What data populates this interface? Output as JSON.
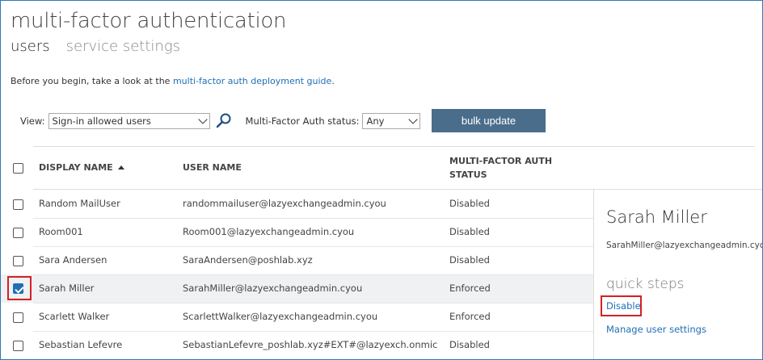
{
  "page": {
    "title": "multi-factor authentication",
    "tabs": [
      {
        "label": "users",
        "active": true
      },
      {
        "label": "service settings",
        "active": false
      }
    ],
    "intro_text": "Before you begin, take a look at the ",
    "intro_link": "multi-factor auth deployment guide",
    "intro_end": "."
  },
  "toolbar": {
    "view_label": "View:",
    "view_value": "Sign-in allowed users",
    "status_label": "Multi-Factor Auth status:",
    "status_value": "Any",
    "bulk_button": "bulk update"
  },
  "table": {
    "columns": {
      "display_name": "DISPLAY NAME",
      "user_name": "USER NAME",
      "mfa_status_line1": "MULTI-FACTOR AUTH",
      "mfa_status_line2": "STATUS"
    },
    "rows": [
      {
        "name": "Random MailUser",
        "user": "randommailuser@lazyexchangeadmin.cyou",
        "status": "Disabled",
        "checked": false
      },
      {
        "name": "Room001",
        "user": "Room001@lazyexchangeadmin.cyou",
        "status": "Disabled",
        "checked": false
      },
      {
        "name": "Sara Andersen",
        "user": "SaraAndersen@poshlab.xyz",
        "status": "Disabled",
        "checked": false
      },
      {
        "name": "Sarah Miller",
        "user": "SarahMiller@lazyexchangeadmin.cyou",
        "status": "Enforced",
        "checked": true
      },
      {
        "name": "Scarlett Walker",
        "user": "ScarlettWalker@lazyexchangeadmin.cyou",
        "status": "Enforced",
        "checked": false
      },
      {
        "name": "Sebastian Lefevre",
        "user": "SebastianLefevre_poshlab.xyz#EXT#@lazyexch.onmicrosoft.com",
        "status": "Disabled",
        "checked": false
      }
    ]
  },
  "details": {
    "name": "Sarah Miller",
    "email": "SarahMiller@lazyexchangeadmin.cyou",
    "quick_steps_label": "quick steps",
    "disable_link": "Disable",
    "manage_link": "Manage user settings"
  },
  "colors": {
    "accent": "#1f6fb5",
    "button": "#4b6d8c",
    "highlight_box": "#d51f26",
    "selected_row": "#f0f1f2"
  },
  "icons": [
    "search-icon",
    "chevron-down-icon",
    "sort-ascending-icon",
    "checkbox-icon"
  ]
}
